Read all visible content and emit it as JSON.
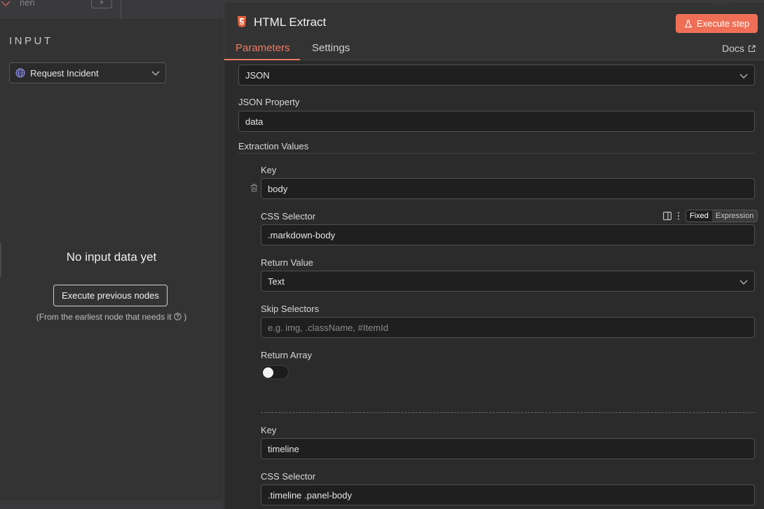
{
  "topbar": {
    "node_label": "nen"
  },
  "input_panel": {
    "title": "INPUT",
    "node_select": {
      "value": "Request Incident"
    },
    "empty_title": "No input data yet",
    "execute_previous_label": "Execute previous nodes",
    "hint_text": "(From the earliest node that needs it",
    "hint_close": ")"
  },
  "header": {
    "title": "HTML Extract",
    "execute_label": "Execute step",
    "tabs": [
      {
        "label": "Parameters",
        "active": true
      },
      {
        "label": "Settings",
        "active": false
      }
    ],
    "docs_label": "Docs"
  },
  "params": {
    "source_select": {
      "value": "JSON"
    },
    "json_property": {
      "label": "JSON Property",
      "value": "data"
    },
    "extraction_values_label": "Extraction Values",
    "items": [
      {
        "key_label": "Key",
        "key_value": "body",
        "css_selector_label": "CSS Selector",
        "css_selector_value": ".markdown-body",
        "mode_fixed": "Fixed",
        "mode_expression": "Expression",
        "return_value_label": "Return Value",
        "return_value": "Text",
        "skip_selectors_label": "Skip Selectors",
        "skip_selectors_placeholder": "e.g. img, .className, #ItemId",
        "return_array_label": "Return Array",
        "return_array_on": false
      },
      {
        "key_label": "Key",
        "key_value": "timeline",
        "css_selector_label": "CSS Selector",
        "css_selector_value": ".timeline .panel-body"
      }
    ]
  },
  "colors": {
    "accent": "#ef6f56",
    "tab_active": "#f07a62",
    "panel_bg": "#2b2b2b",
    "input_bg": "#1f1f1f"
  },
  "icons": [
    "workflow-icon",
    "globe-icon",
    "chevron-down-icon",
    "help-circle-icon",
    "html5-icon",
    "flask-icon",
    "external-link-icon",
    "trash-icon",
    "split-panel-icon",
    "kebab-menu-icon"
  ]
}
